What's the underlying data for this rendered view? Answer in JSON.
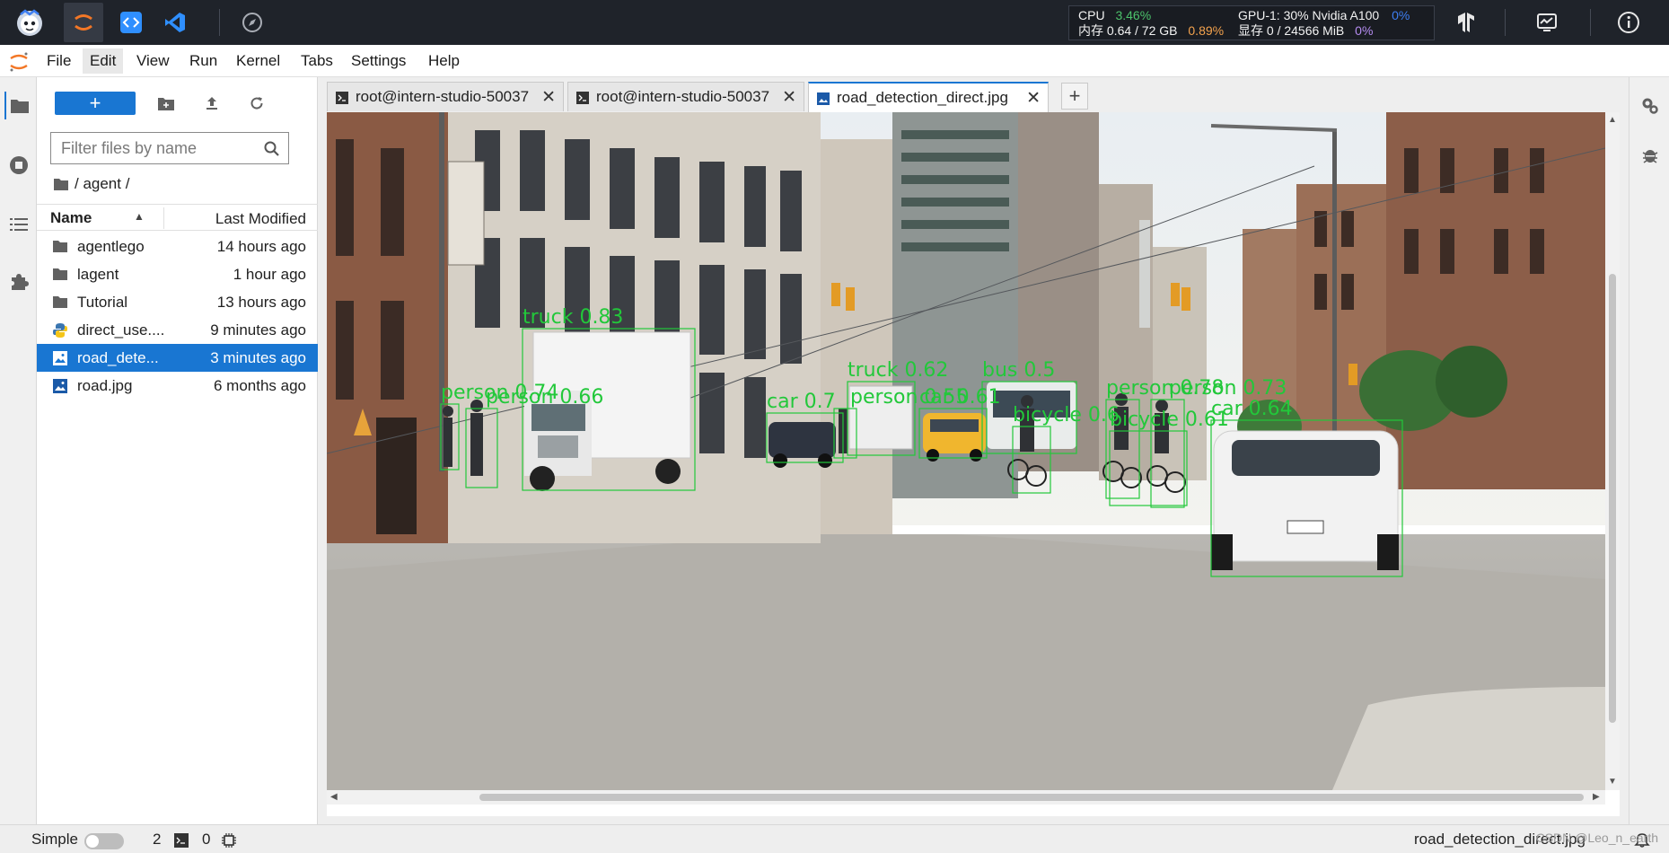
{
  "topbar": {
    "resources": {
      "cpu_label": "CPU",
      "cpu_value": "3.46%",
      "mem_label": "内存 0.64 / 72 GB",
      "mem_value": "0.89%",
      "gpu_label": "GPU-1: 30% Nvidia A100",
      "gpu_value": "0%",
      "vram_label": "显存 0 / 24566 MiB",
      "vram_value": "0%"
    }
  },
  "menubar": {
    "items": [
      "File",
      "Edit",
      "View",
      "Run",
      "Kernel",
      "Tabs",
      "Settings",
      "Help"
    ],
    "active": "Edit"
  },
  "filebrowser": {
    "new_label": "+",
    "filter_placeholder": "Filter files by name",
    "breadcrumb": "/ agent /",
    "columns": {
      "name": "Name",
      "modified": "Last Modified"
    },
    "files": [
      {
        "name": "agentlego",
        "modified": "14 hours ago",
        "type": "folder",
        "selected": false
      },
      {
        "name": "lagent",
        "modified": "1 hour ago",
        "type": "folder",
        "selected": false
      },
      {
        "name": "Tutorial",
        "modified": "13 hours ago",
        "type": "folder",
        "selected": false
      },
      {
        "name": "direct_use....",
        "modified": "9 minutes ago",
        "type": "python",
        "selected": false
      },
      {
        "name": "road_dete...",
        "modified": "3 minutes ago",
        "type": "image",
        "selected": true
      },
      {
        "name": "road.jpg",
        "modified": "6 months ago",
        "type": "image",
        "selected": false
      }
    ]
  },
  "tabs": [
    {
      "label": "root@intern-studio-50037",
      "icon": "terminal-icon",
      "active": false
    },
    {
      "label": "root@intern-studio-50037",
      "icon": "terminal-icon",
      "active": false
    },
    {
      "label": "road_detection_direct.jpg",
      "icon": "image-icon",
      "active": true
    }
  ],
  "detections": [
    {
      "label": "truck 0.83"
    },
    {
      "label": "person 0.74"
    },
    {
      "label": "person 0.66"
    },
    {
      "label": "car 0.7"
    },
    {
      "label": "truck 0.62"
    },
    {
      "label": "person 0.55"
    },
    {
      "label": "car 0.61"
    },
    {
      "label": "bus 0.5"
    },
    {
      "label": "person 0.78"
    },
    {
      "label": "person 0.73"
    },
    {
      "label": "car 0.64"
    },
    {
      "label": "bicycle 0.6"
    },
    {
      "label": "bicycle 0.61"
    }
  ],
  "statusbar": {
    "mode": "Simple",
    "kernels": "2",
    "terminals": "0",
    "filename": "road_detection_direct.jpg",
    "watermark": "CSDN @Leo_n_earth"
  },
  "colors": {
    "accent": "#1976d2",
    "topbar_bg": "#1f232a",
    "detection_box": "#22c83a"
  }
}
